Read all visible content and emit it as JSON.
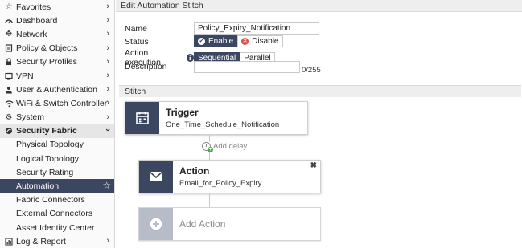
{
  "sidebar": {
    "items": [
      {
        "label": "Favorites",
        "icon": "star-icon"
      },
      {
        "label": "Dashboard",
        "icon": "dashboard-icon"
      },
      {
        "label": "Network",
        "icon": "network-icon"
      },
      {
        "label": "Policy & Objects",
        "icon": "policy-icon"
      },
      {
        "label": "Security Profiles",
        "icon": "lock-icon"
      },
      {
        "label": "VPN",
        "icon": "vpn-icon"
      },
      {
        "label": "User & Authentication",
        "icon": "user-icon"
      },
      {
        "label": "WiFi & Switch Controller",
        "icon": "wifi-icon"
      },
      {
        "label": "System",
        "icon": "gear-icon"
      },
      {
        "label": "Security Fabric",
        "icon": "fabric-icon"
      }
    ],
    "sub_items": [
      "Physical Topology",
      "Logical Topology",
      "Security Rating",
      "Automation",
      "Fabric Connectors",
      "External Connectors",
      "Asset Identity Center"
    ],
    "last_item": {
      "label": "Log & Report",
      "icon": "chart-icon"
    }
  },
  "header": {
    "title": "Edit Automation Stitch"
  },
  "form": {
    "name_label": "Name",
    "name_value": "Policy_Expiry_Notification",
    "status_label": "Status",
    "status_enable": "Enable",
    "status_disable": "Disable",
    "execution_label": "Action execution",
    "execution_sequential": "Sequential",
    "execution_parallel": "Parallel",
    "description_label": "Description",
    "description_counter": "0/255"
  },
  "stitch": {
    "section_title": "Stitch",
    "trigger_title": "Trigger",
    "trigger_sub": "One_Time_Schedule_Notification",
    "add_delay": "Add delay",
    "action_title": "Action",
    "action_sub": "Email_for_Policy_Expiry",
    "add_action": "Add Action"
  },
  "colors": {
    "accent": "#3b4660",
    "enable_check": "#3b4660",
    "disable_x": "#d9534f",
    "delay_plus": "#4aa84a"
  }
}
